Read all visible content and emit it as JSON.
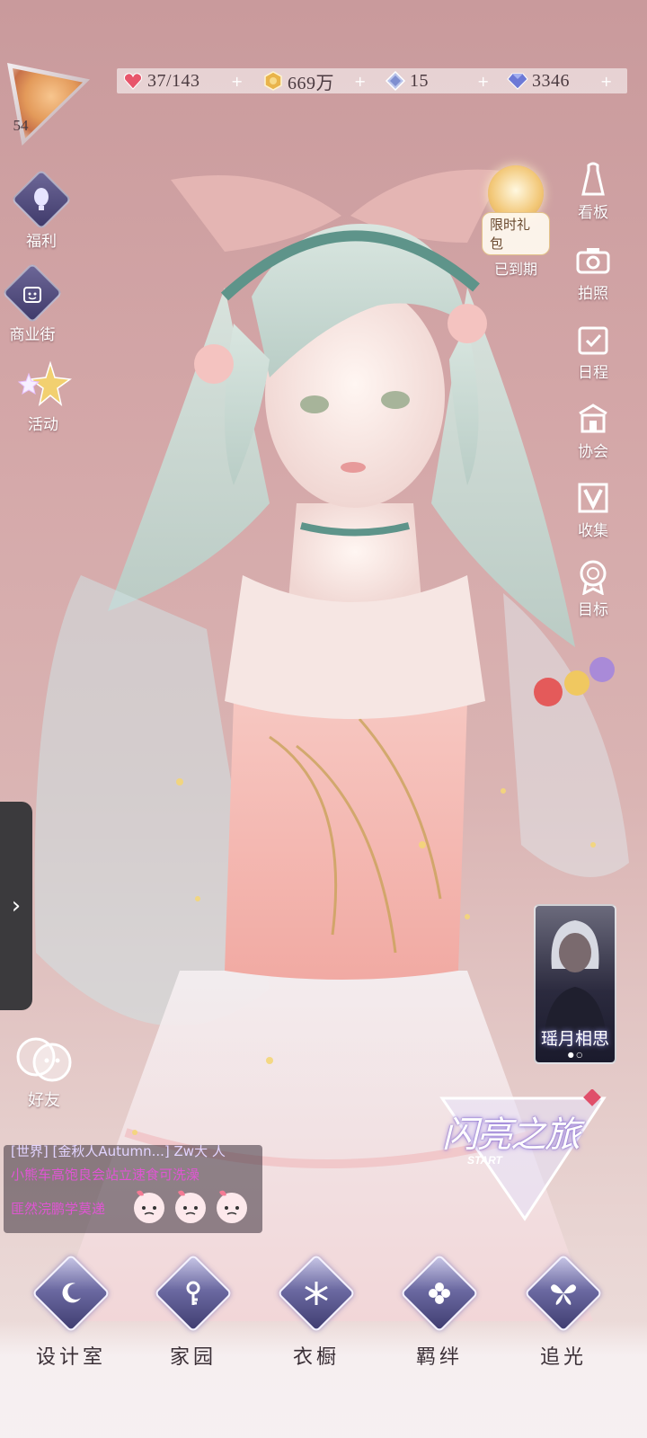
{
  "player": {
    "level": "54",
    "avatar_icon": "fox-avatar"
  },
  "currencies": [
    {
      "name": "stamina",
      "icon": "heart-gem-icon",
      "value": "37/143"
    },
    {
      "name": "gold",
      "icon": "gold-coin-icon",
      "value": "669万"
    },
    {
      "name": "crystal",
      "icon": "crystal-icon",
      "value": "15"
    },
    {
      "name": "diamond",
      "icon": "diamond-icon",
      "value": "3346"
    }
  ],
  "left_menu": [
    {
      "label": "福利",
      "icon": "balloon-icon"
    },
    {
      "label": "商业街",
      "icon": "shopping-bag-icon"
    },
    {
      "label": "活动",
      "icon": "stars-icon"
    }
  ],
  "gift": {
    "tag": "限时礼包",
    "status": "已到期"
  },
  "right_menu": [
    {
      "label": "看板",
      "icon": "dress-board-icon"
    },
    {
      "label": "拍照",
      "icon": "camera-icon"
    },
    {
      "label": "日程",
      "icon": "calendar-icon"
    },
    {
      "label": "协会",
      "icon": "guild-icon"
    },
    {
      "label": "收集",
      "icon": "collection-icon"
    },
    {
      "label": "目标",
      "icon": "target-badge-icon"
    }
  ],
  "friends": {
    "label": "好友"
  },
  "chat": {
    "line1": "[世界] [金秋人Autumn...] Zw大 人",
    "line2": "小熊车高饱良会站立速食可洗澡",
    "line3": "匪然浣鹏学莫递"
  },
  "card": {
    "title": "瑶月相思"
  },
  "event": {
    "title": "闪亮之旅",
    "subtitle": "START"
  },
  "bottom_nav": [
    {
      "label": "设计室",
      "icon": "moon-pen-icon"
    },
    {
      "label": "家园",
      "icon": "key-icon"
    },
    {
      "label": "衣橱",
      "icon": "snowflake-icon"
    },
    {
      "label": "羁绊",
      "icon": "clover-icon"
    },
    {
      "label": "追光",
      "icon": "butterfly-icon"
    }
  ],
  "colors": {
    "background": "#d4a7a8",
    "nav_gem": "#6c6aa2",
    "chat_highlight": "#e055d4"
  }
}
